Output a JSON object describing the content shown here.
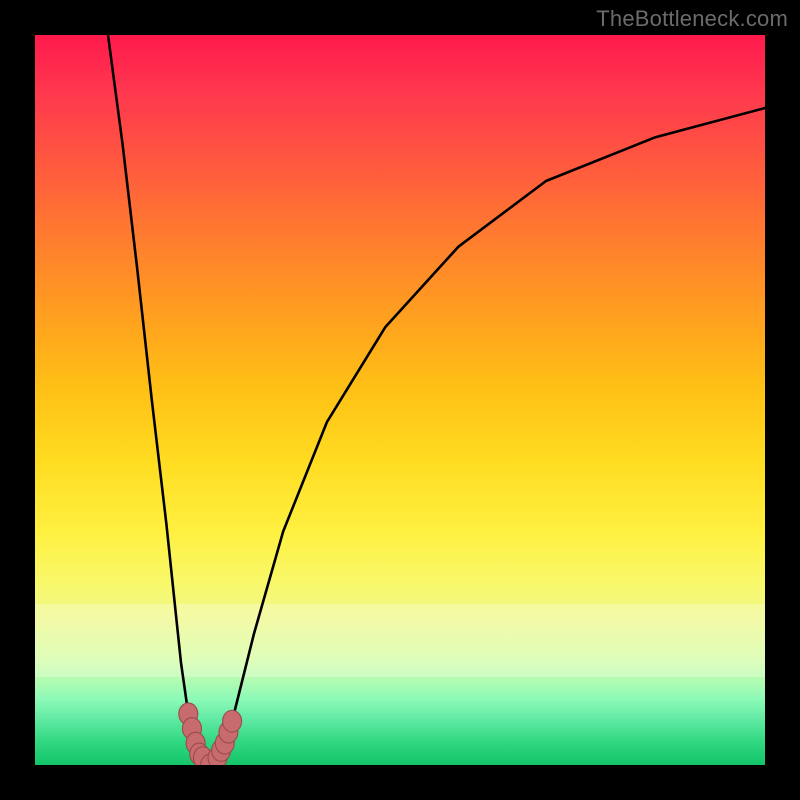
{
  "watermark": "TheBottleneck.com",
  "colors": {
    "page_bg": "#000000",
    "curve": "#000000",
    "marker_fill": "#c76b6e",
    "marker_stroke": "#9a4a4d",
    "gradient_top": "#ff1a4d",
    "gradient_bottom": "#14c468",
    "watermark_text": "#6b6b6b"
  },
  "chart_data": {
    "type": "line",
    "title": "",
    "xlabel": "",
    "ylabel": "",
    "xlim": [
      0,
      100
    ],
    "ylim": [
      0,
      100
    ],
    "grid": false,
    "legend": false,
    "series": [
      {
        "name": "curve-left",
        "x": [
          10,
          12,
          14,
          16,
          18,
          20,
          21,
          22,
          23,
          24
        ],
        "values": [
          100,
          85,
          68,
          50,
          33,
          14,
          7,
          3,
          1,
          0
        ]
      },
      {
        "name": "curve-right",
        "x": [
          24,
          25,
          26,
          27,
          28,
          30,
          34,
          40,
          48,
          58,
          70,
          85,
          100
        ],
        "values": [
          0,
          1,
          3,
          6,
          10,
          18,
          32,
          47,
          60,
          71,
          80,
          86,
          90
        ]
      }
    ],
    "markers": {
      "name": "highlight-band",
      "x": [
        21.0,
        21.5,
        22.0,
        22.5,
        23.0,
        24.0,
        25.0,
        25.5,
        26.0,
        26.5,
        27.0
      ],
      "values": [
        7.0,
        5.0,
        3.0,
        1.5,
        1.0,
        0.0,
        1.0,
        2.0,
        3.0,
        4.5,
        6.0
      ]
    }
  }
}
